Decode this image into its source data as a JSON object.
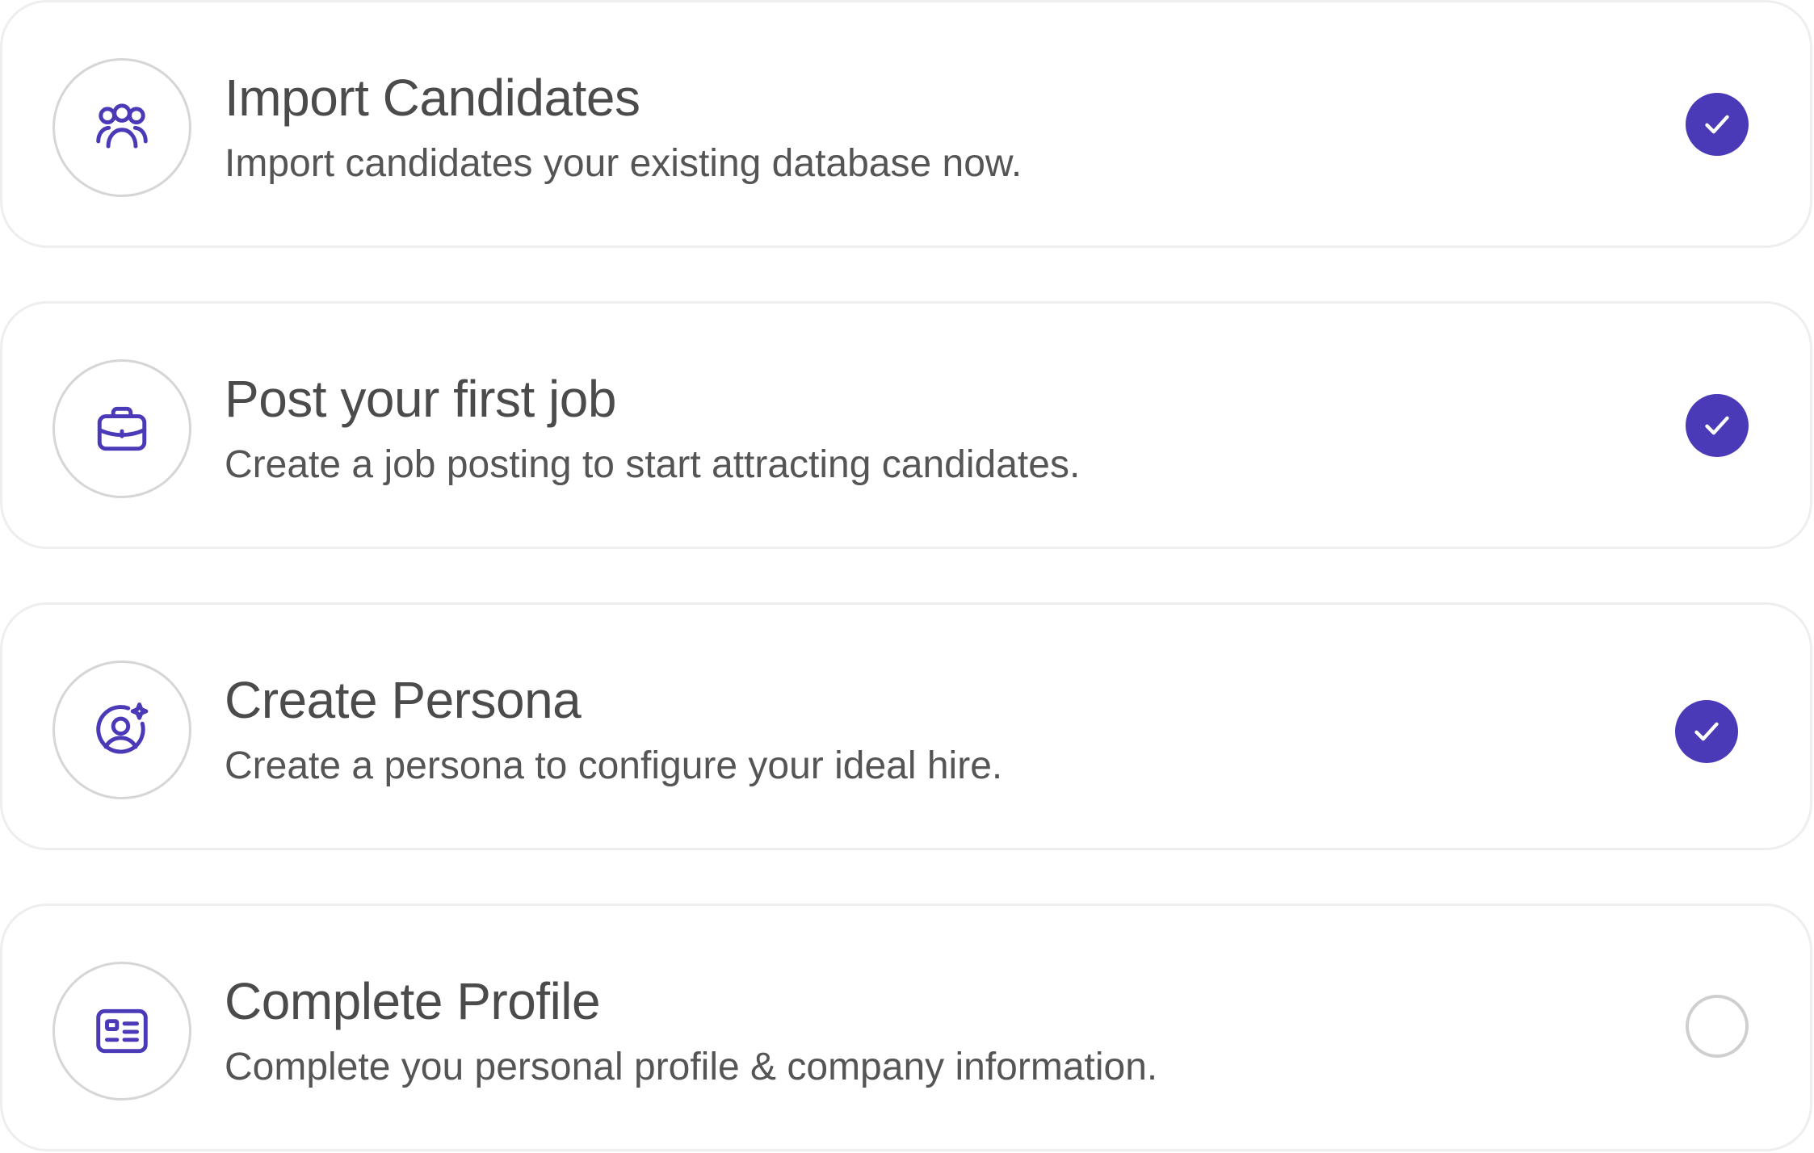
{
  "colors": {
    "accent": "#4a3ab8",
    "card_border": "#eeeeee",
    "icon_ring": "#d6d6d6",
    "unchecked_ring": "#cfcfcf",
    "title_text": "#4b4b4b",
    "desc_text": "#555555"
  },
  "steps": [
    {
      "icon": "users-group-icon",
      "title": "Import Candidates",
      "description": "Import candidates your existing database now.",
      "completed": true
    },
    {
      "icon": "briefcase-icon",
      "title": "Post your first job",
      "description": "Create a job posting to start attracting candidates.",
      "completed": true
    },
    {
      "icon": "user-sparkle-icon",
      "title": "Create Persona",
      "description": "Create a persona to configure your ideal hire.",
      "completed": true
    },
    {
      "icon": "id-card-icon",
      "title": "Complete Profile",
      "description": "Complete you personal profile & company information.",
      "completed": false
    }
  ]
}
